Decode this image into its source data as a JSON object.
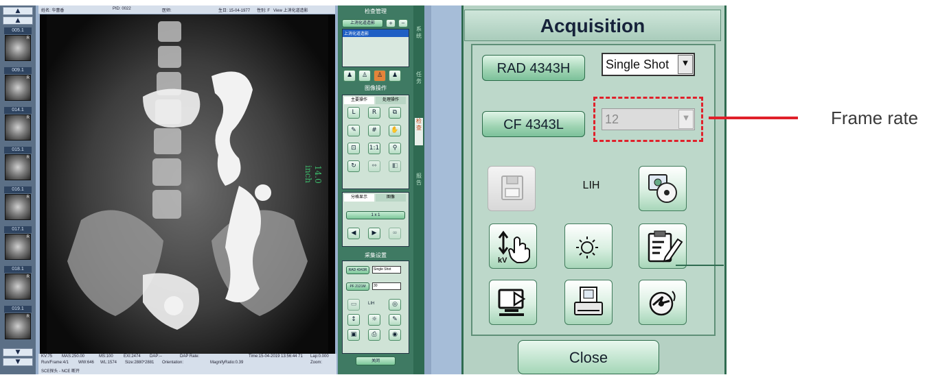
{
  "viewer": {
    "thumbnails": [
      {
        "label": "005.1"
      },
      {
        "label": "009.1"
      },
      {
        "label": "014.1"
      },
      {
        "label": "015.1"
      },
      {
        "label": "016.1"
      },
      {
        "label": "017.1"
      },
      {
        "label": "018.1"
      },
      {
        "label": "019.1"
      }
    ],
    "thumb_marker": "R",
    "nav": {
      "top": "▲",
      "up": "▲",
      "down": "▼",
      "bottom": "▼"
    },
    "top_info": {
      "name": "姓名: 华蕾香",
      "pid": "PID: 0022",
      "doctor": "医师:",
      "birth": "生日: 15-04-1977",
      "sex": "性别: F",
      "view": "View 上消化道造影"
    },
    "ruler": "14.0 inch",
    "bottom_info": {
      "kv": "KV:75",
      "mas": "MAS:250.00",
      "ms": "MS:100",
      "exi": "EXI:2474",
      "dap": "DAP:--",
      "dap_rate": "DAP Rate:",
      "time": "Time:15-04-2019 13:56:44 71",
      "lap": "Lap:0.000",
      "run": "Run/Frame:4/1",
      "ww": "WW:646",
      "wl": "WL:1574",
      "size": "Size:2880*2881",
      "orientation": "Orientation:",
      "magnify": "MagnifyRatio:0.39",
      "zoom": "Zoom:",
      "footer": "SCE探头 - NCE 断开"
    },
    "side_panel": {
      "exam_header": "检查管理",
      "exam_button": "上消化道造影",
      "exam_item": "上消化道造影",
      "image_header": "图像操作",
      "tab_main": "主要操作",
      "tab_process": "处理操作",
      "split_tab": "分格显示",
      "split_tab2": "图像",
      "layout_btn": "1 x 1",
      "acq_header": "采集设置",
      "rad_btn": "RAD 4343R",
      "rad_mode": "Single Shot",
      "pf_btn": "PF 2121M",
      "pf_rate": "30",
      "lih": "LIH",
      "close": "关闭",
      "vtabs": [
        "系统",
        "任务",
        "检查",
        "报告"
      ]
    }
  },
  "acquisition": {
    "title": "Acquisition",
    "rad_button": "RAD 4343H",
    "rad_mode": "Single Shot",
    "cf_button": "CF 4343L",
    "frame_rate_value": "12",
    "lih_label": "LIH",
    "close_button": "Close",
    "icons": [
      "save-icon",
      "image-export-icon",
      "kv-adjust-icon",
      "brightness-icon",
      "report-edit-icon",
      "display-icon",
      "print-icon",
      "disc-burn-icon"
    ]
  },
  "annotation": {
    "label": "Frame rate",
    "color": "#e0202a"
  }
}
